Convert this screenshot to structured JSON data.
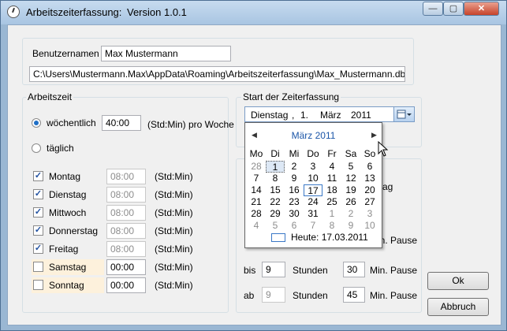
{
  "window": {
    "title": "Arbeitszeiterfassung:",
    "version": "Version 1.0.1",
    "controls": {
      "minimize": "—",
      "maximize": "▢",
      "close": "✕"
    }
  },
  "user": {
    "label": "Benutzernamen",
    "name": "Max Mustermann",
    "db_path": "C:\\Users\\Mustermann.Max\\AppData\\Roaming\\Arbeitszeiterfassung\\Max_Mustermann.db3"
  },
  "arbeitszeit": {
    "legend": "Arbeitszeit",
    "weekly_label": "wöchentlich",
    "weekly_value": "40:00",
    "weekly_unit": "(Std:Min) pro Woche",
    "daily_label": "täglich",
    "days": [
      {
        "name": "Montag",
        "value": "08:00",
        "unit": "(Std:Min)",
        "checked": true
      },
      {
        "name": "Dienstag",
        "value": "08:00",
        "unit": "(Std:Min)",
        "checked": true
      },
      {
        "name": "Mittwoch",
        "value": "08:00",
        "unit": "(Std:Min)",
        "checked": true
      },
      {
        "name": "Donnerstag",
        "value": "08:00",
        "unit": "(Std:Min)",
        "checked": true
      },
      {
        "name": "Freitag",
        "value": "08:00",
        "unit": "(Std:Min)",
        "checked": true
      },
      {
        "name": "Samstag",
        "value": "00:00",
        "unit": "(Std:Min)",
        "checked": false
      },
      {
        "name": "Sonntag",
        "value": "00:00",
        "unit": "(Std:Min)",
        "checked": false
      }
    ]
  },
  "start": {
    "legend": "Start der Zeiterfassung",
    "weekday": "Dienstag",
    "sep": ",",
    "day": "1.",
    "month": "März",
    "year": "2011"
  },
  "pause": {
    "partial_tag": "ag",
    "partial_pause": "Min. Pause",
    "rows": [
      {
        "prefix": "bis",
        "hours": "9",
        "hours_label": "Stunden",
        "minutes": "30",
        "pause_label": "Min. Pause"
      },
      {
        "prefix": "ab",
        "hours": "9",
        "hours_label": "Stunden",
        "minutes": "45",
        "pause_label": "Min. Pause"
      }
    ]
  },
  "calendar": {
    "month_title": "März 2011",
    "prev": "◀",
    "next": "▶",
    "weekdays": [
      "Mo",
      "Di",
      "Mi",
      "Do",
      "Fr",
      "Sa",
      "So"
    ],
    "weeks": [
      [
        "28",
        "1",
        "2",
        "3",
        "4",
        "5",
        "6"
      ],
      [
        "7",
        "8",
        "9",
        "10",
        "11",
        "12",
        "13"
      ],
      [
        "14",
        "15",
        "16",
        "17",
        "18",
        "19",
        "20"
      ],
      [
        "21",
        "22",
        "23",
        "24",
        "25",
        "26",
        "27"
      ],
      [
        "28",
        "29",
        "30",
        "31",
        "1",
        "2",
        "3"
      ],
      [
        "4",
        "5",
        "6",
        "7",
        "8",
        "9",
        "10"
      ]
    ],
    "today_label": "Heute: 17.03.2011"
  },
  "buttons": {
    "ok": "Ok",
    "cancel": "Abbruch"
  },
  "colors": {
    "accent": "#1c56a8",
    "weekend_bg": "#fdf1dc",
    "titlebar": "#b7cfe8"
  }
}
